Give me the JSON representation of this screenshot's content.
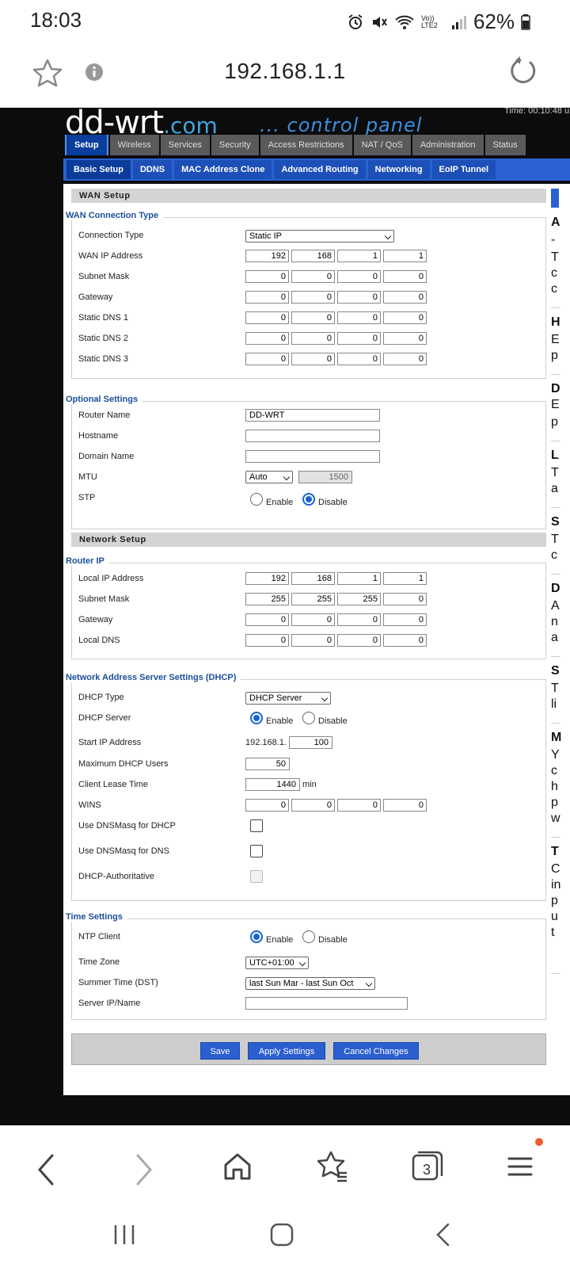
{
  "status": {
    "time": "18:03",
    "battery": "62%",
    "volte": "Vo)) LTE2"
  },
  "browser": {
    "url": "192.168.1.1",
    "tab_count": "3"
  },
  "header": {
    "logo_main": "dd-wrt",
    "logo_suffix": ".com",
    "panel": "... control panel",
    "clock": "Time: 00:10:48 u"
  },
  "tabs": [
    "Setup",
    "Wireless",
    "Services",
    "Security",
    "Access Restrictions",
    "NAT / QoS",
    "Administration",
    "Status"
  ],
  "subtabs": [
    "Basic Setup",
    "DDNS",
    "MAC Address Clone",
    "Advanced Routing",
    "Networking",
    "EoIP Tunnel"
  ],
  "wan": {
    "section": "WAN Setup",
    "legend": "WAN Connection Type",
    "connection_type_label": "Connection Type",
    "connection_type": "Static IP",
    "rows": [
      {
        "label": "WAN IP Address",
        "octets": [
          "192",
          "168",
          "1",
          "1"
        ]
      },
      {
        "label": "Subnet Mask",
        "octets": [
          "0",
          "0",
          "0",
          "0"
        ]
      },
      {
        "label": "Gateway",
        "octets": [
          "0",
          "0",
          "0",
          "0"
        ]
      },
      {
        "label": "Static DNS 1",
        "octets": [
          "0",
          "0",
          "0",
          "0"
        ]
      },
      {
        "label": "Static DNS 2",
        "octets": [
          "0",
          "0",
          "0",
          "0"
        ]
      },
      {
        "label": "Static DNS 3",
        "octets": [
          "0",
          "0",
          "0",
          "0"
        ]
      }
    ]
  },
  "optional": {
    "legend": "Optional Settings",
    "router_name_label": "Router Name",
    "router_name": "DD-WRT",
    "hostname_label": "Hostname",
    "hostname": "",
    "domain_label": "Domain Name",
    "domain": "",
    "mtu_label": "MTU",
    "mtu_mode": "Auto",
    "mtu_value": "1500",
    "stp_label": "STP",
    "enable": "Enable",
    "disable": "Disable"
  },
  "network": {
    "section": "Network Setup",
    "legend": "Router IP",
    "rows": [
      {
        "label": "Local IP Address",
        "octets": [
          "192",
          "168",
          "1",
          "1"
        ]
      },
      {
        "label": "Subnet Mask",
        "octets": [
          "255",
          "255",
          "255",
          "0"
        ]
      },
      {
        "label": "Gateway",
        "octets": [
          "0",
          "0",
          "0",
          "0"
        ]
      },
      {
        "label": "Local DNS",
        "octets": [
          "0",
          "0",
          "0",
          "0"
        ]
      }
    ]
  },
  "dhcp": {
    "legend": "Network Address Server Settings (DHCP)",
    "type_label": "DHCP Type",
    "type": "DHCP Server",
    "server_label": "DHCP Server",
    "enable": "Enable",
    "disable": "Disable",
    "start_label": "Start IP Address",
    "start_prefix": "192.168.1.",
    "start_value": "100",
    "max_label": "Maximum DHCP Users",
    "max_value": "50",
    "lease_label": "Client Lease Time",
    "lease_value": "1440",
    "lease_unit": "min",
    "wins_label": "WINS",
    "wins": [
      "0",
      "0",
      "0",
      "0"
    ],
    "dnsmasq_dhcp_label": "Use DNSMasq for DHCP",
    "dnsmasq_dns_label": "Use DNSMasq for DNS",
    "authoritative_label": "DHCP-Authoritative"
  },
  "time": {
    "legend": "Time Settings",
    "ntp_label": "NTP Client",
    "enable": "Enable",
    "disable": "Disable",
    "zone_label": "Time Zone",
    "zone": "UTC+01:00",
    "dst_label": "Summer Time (DST)",
    "dst": "last Sun Mar - last Sun Oct",
    "server_label": "Server IP/Name",
    "server": ""
  },
  "buttons": {
    "save": "Save",
    "apply": "Apply Settings",
    "cancel": "Cancel Changes"
  },
  "help_letters": [
    "A",
    "-",
    "T",
    "c",
    "c",
    "H",
    "E",
    "p",
    "D",
    "E",
    "p",
    "L",
    "T",
    "a",
    "S",
    "T",
    "c",
    "D",
    "A",
    "n",
    "a",
    "S",
    "T",
    "li",
    "M",
    "Y",
    "c",
    "h",
    "p",
    "w",
    "T",
    "C",
    "in",
    "p",
    "u",
    "t"
  ]
}
